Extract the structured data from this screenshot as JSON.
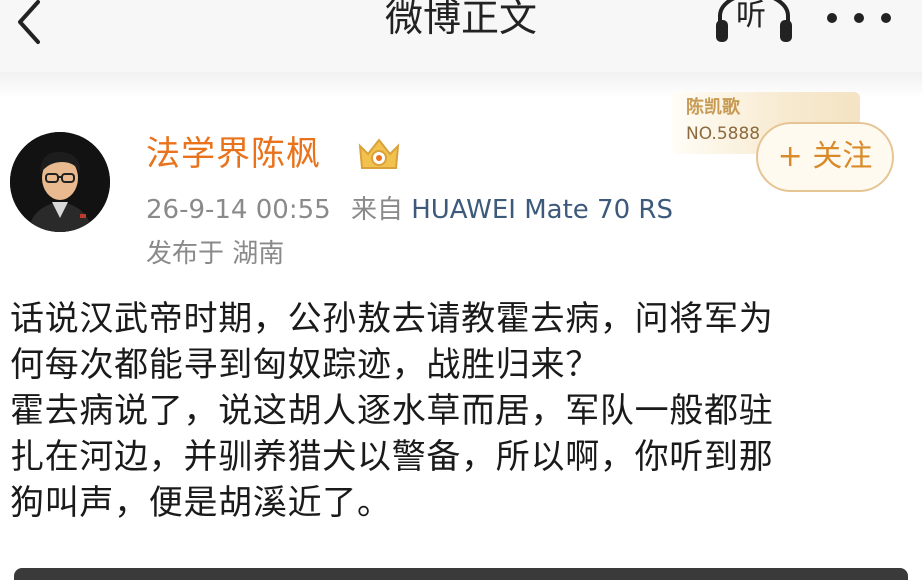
{
  "nav": {
    "title": "微博正文",
    "listen_label": "听"
  },
  "author": {
    "name": "法学界陈枫",
    "badge_icon": "vip-crown-badge",
    "fan_badge": {
      "name": "陈凯歌",
      "number": "NO.5888"
    },
    "follow_label": "+ 关注"
  },
  "post": {
    "datetime": "26-9-14 00:55",
    "source_prefix": "来自",
    "source_device": "HUAWEI Mate 70 RS",
    "location_prefix": "发布于",
    "location": "湖南",
    "lines": [
      "话说汉武帝时期，公孙敖去请教霍去病，问将军为",
      "何每次都能寻到匈奴踪迹，战胜归来？",
      "霍去病说了，说这胡人逐水草而居，军队一般都驻",
      "扎在河边，并驯养猎犬以警备，所以啊，你听到那",
      "狗叫声，便是胡溪近了。"
    ]
  },
  "colors": {
    "author_name": "#e8731c",
    "follow_border": "#e6c594",
    "meta_text": "#8a8a8a",
    "source_device": "#3d5a7a"
  }
}
